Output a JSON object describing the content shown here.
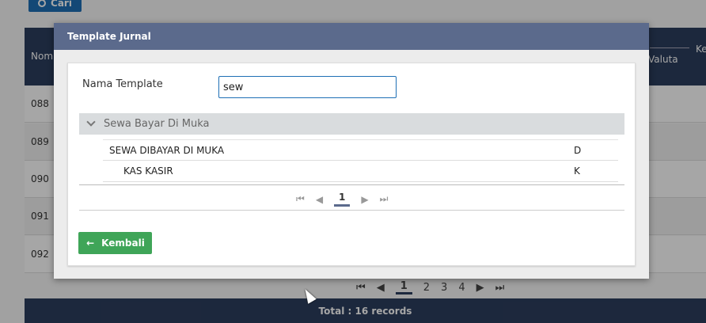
{
  "background": {
    "search_button_label": "Cari",
    "table_header": {
      "col_no": "Nom",
      "col_valuta": "Valuta",
      "col_ket": "Ke"
    },
    "rows": [
      "088",
      "089",
      "090",
      "091",
      "092"
    ],
    "pager": {
      "pages": [
        "1",
        "2",
        "3",
        "4"
      ],
      "current": "1"
    },
    "footer_total": "Total : 16 records"
  },
  "dialog": {
    "title": "Template Jurnal",
    "field_label": "Nama Template",
    "field_value": "sew",
    "group_label": "Sewa Bayar Di Muka",
    "entries": [
      {
        "name": "SEWA DIBAYAR DI MUKA",
        "type": "D"
      },
      {
        "name": "KAS KASIR",
        "type": "K"
      }
    ],
    "pager": {
      "current": "1",
      "first": "⏮",
      "prev": "◀",
      "next": "▶",
      "last": "⏭"
    },
    "back_button_label": "Kembali",
    "back_icon": "arrow-left-icon"
  }
}
